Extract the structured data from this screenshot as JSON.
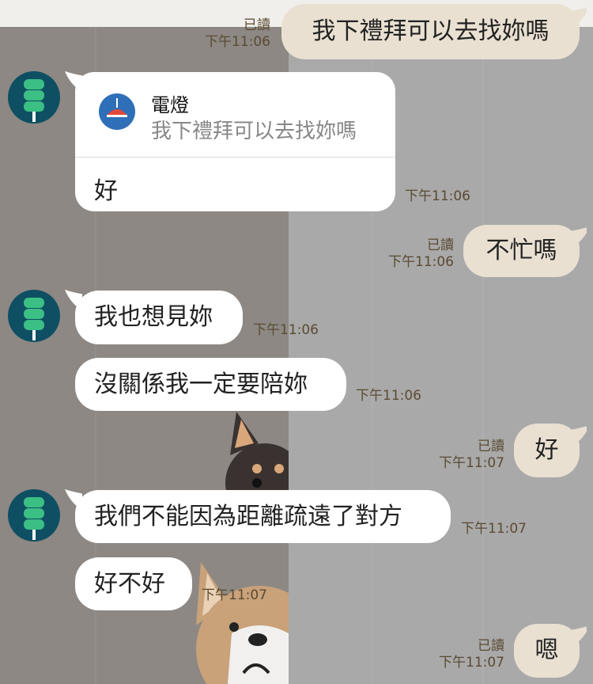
{
  "messages": [
    {
      "id": "m1",
      "side": "out",
      "text": "我下禮拜可以去找妳嗎",
      "read": "已讀",
      "time": "下午11:06"
    },
    {
      "id": "m2",
      "side": "in",
      "reply_to": {
        "name": "電燈",
        "text": "我下禮拜可以去找妳嗎"
      },
      "text": "好",
      "time": "下午11:06"
    },
    {
      "id": "m3",
      "side": "out",
      "text": "不忙嗎",
      "read": "已讀",
      "time": "下午11:06"
    },
    {
      "id": "m4",
      "side": "in",
      "text": "我也想見妳",
      "time": "下午11:06"
    },
    {
      "id": "m5",
      "side": "in",
      "text": "沒關係我一定要陪妳",
      "time": "下午11:06"
    },
    {
      "id": "m6",
      "side": "out",
      "text": "好",
      "read": "已讀",
      "time": "下午11:07"
    },
    {
      "id": "m7",
      "side": "in",
      "text": "我們不能因為距離疏遠了對方",
      "time": "下午11:07"
    },
    {
      "id": "m8",
      "side": "in",
      "text": "好不好",
      "time": "下午11:07"
    },
    {
      "id": "m9",
      "side": "out",
      "text": "嗯",
      "read": "已讀",
      "time": "下午11:07"
    }
  ],
  "colors": {
    "incoming_bubble": "#ffffff",
    "outgoing_bubble": "#e9e0d2",
    "avatar_bg": "#0e4f63",
    "avatar_icon": "#3bbf84",
    "meta_text": "#5a4a33",
    "lamp_icon_bg": "#2f6fb8",
    "lamp_icon_shade": "#e2483a"
  },
  "icons": {
    "avatar": "green-tree-icon",
    "reply_quote": "lamp-icon"
  }
}
